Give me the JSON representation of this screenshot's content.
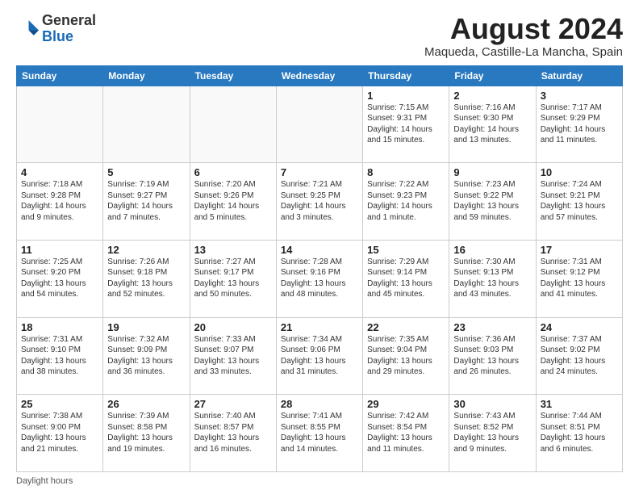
{
  "header": {
    "logo_general": "General",
    "logo_blue": "Blue",
    "month_title": "August 2024",
    "subtitle": "Maqueda, Castille-La Mancha, Spain"
  },
  "weekdays": [
    "Sunday",
    "Monday",
    "Tuesday",
    "Wednesday",
    "Thursday",
    "Friday",
    "Saturday"
  ],
  "weeks": [
    [
      {
        "day": "",
        "info": ""
      },
      {
        "day": "",
        "info": ""
      },
      {
        "day": "",
        "info": ""
      },
      {
        "day": "",
        "info": ""
      },
      {
        "day": "1",
        "info": "Sunrise: 7:15 AM\nSunset: 9:31 PM\nDaylight: 14 hours\nand 15 minutes."
      },
      {
        "day": "2",
        "info": "Sunrise: 7:16 AM\nSunset: 9:30 PM\nDaylight: 14 hours\nand 13 minutes."
      },
      {
        "day": "3",
        "info": "Sunrise: 7:17 AM\nSunset: 9:29 PM\nDaylight: 14 hours\nand 11 minutes."
      }
    ],
    [
      {
        "day": "4",
        "info": "Sunrise: 7:18 AM\nSunset: 9:28 PM\nDaylight: 14 hours\nand 9 minutes."
      },
      {
        "day": "5",
        "info": "Sunrise: 7:19 AM\nSunset: 9:27 PM\nDaylight: 14 hours\nand 7 minutes."
      },
      {
        "day": "6",
        "info": "Sunrise: 7:20 AM\nSunset: 9:26 PM\nDaylight: 14 hours\nand 5 minutes."
      },
      {
        "day": "7",
        "info": "Sunrise: 7:21 AM\nSunset: 9:25 PM\nDaylight: 14 hours\nand 3 minutes."
      },
      {
        "day": "8",
        "info": "Sunrise: 7:22 AM\nSunset: 9:23 PM\nDaylight: 14 hours\nand 1 minute."
      },
      {
        "day": "9",
        "info": "Sunrise: 7:23 AM\nSunset: 9:22 PM\nDaylight: 13 hours\nand 59 minutes."
      },
      {
        "day": "10",
        "info": "Sunrise: 7:24 AM\nSunset: 9:21 PM\nDaylight: 13 hours\nand 57 minutes."
      }
    ],
    [
      {
        "day": "11",
        "info": "Sunrise: 7:25 AM\nSunset: 9:20 PM\nDaylight: 13 hours\nand 54 minutes."
      },
      {
        "day": "12",
        "info": "Sunrise: 7:26 AM\nSunset: 9:18 PM\nDaylight: 13 hours\nand 52 minutes."
      },
      {
        "day": "13",
        "info": "Sunrise: 7:27 AM\nSunset: 9:17 PM\nDaylight: 13 hours\nand 50 minutes."
      },
      {
        "day": "14",
        "info": "Sunrise: 7:28 AM\nSunset: 9:16 PM\nDaylight: 13 hours\nand 48 minutes."
      },
      {
        "day": "15",
        "info": "Sunrise: 7:29 AM\nSunset: 9:14 PM\nDaylight: 13 hours\nand 45 minutes."
      },
      {
        "day": "16",
        "info": "Sunrise: 7:30 AM\nSunset: 9:13 PM\nDaylight: 13 hours\nand 43 minutes."
      },
      {
        "day": "17",
        "info": "Sunrise: 7:31 AM\nSunset: 9:12 PM\nDaylight: 13 hours\nand 41 minutes."
      }
    ],
    [
      {
        "day": "18",
        "info": "Sunrise: 7:31 AM\nSunset: 9:10 PM\nDaylight: 13 hours\nand 38 minutes."
      },
      {
        "day": "19",
        "info": "Sunrise: 7:32 AM\nSunset: 9:09 PM\nDaylight: 13 hours\nand 36 minutes."
      },
      {
        "day": "20",
        "info": "Sunrise: 7:33 AM\nSunset: 9:07 PM\nDaylight: 13 hours\nand 33 minutes."
      },
      {
        "day": "21",
        "info": "Sunrise: 7:34 AM\nSunset: 9:06 PM\nDaylight: 13 hours\nand 31 minutes."
      },
      {
        "day": "22",
        "info": "Sunrise: 7:35 AM\nSunset: 9:04 PM\nDaylight: 13 hours\nand 29 minutes."
      },
      {
        "day": "23",
        "info": "Sunrise: 7:36 AM\nSunset: 9:03 PM\nDaylight: 13 hours\nand 26 minutes."
      },
      {
        "day": "24",
        "info": "Sunrise: 7:37 AM\nSunset: 9:02 PM\nDaylight: 13 hours\nand 24 minutes."
      }
    ],
    [
      {
        "day": "25",
        "info": "Sunrise: 7:38 AM\nSunset: 9:00 PM\nDaylight: 13 hours\nand 21 minutes."
      },
      {
        "day": "26",
        "info": "Sunrise: 7:39 AM\nSunset: 8:58 PM\nDaylight: 13 hours\nand 19 minutes."
      },
      {
        "day": "27",
        "info": "Sunrise: 7:40 AM\nSunset: 8:57 PM\nDaylight: 13 hours\nand 16 minutes."
      },
      {
        "day": "28",
        "info": "Sunrise: 7:41 AM\nSunset: 8:55 PM\nDaylight: 13 hours\nand 14 minutes."
      },
      {
        "day": "29",
        "info": "Sunrise: 7:42 AM\nSunset: 8:54 PM\nDaylight: 13 hours\nand 11 minutes."
      },
      {
        "day": "30",
        "info": "Sunrise: 7:43 AM\nSunset: 8:52 PM\nDaylight: 13 hours\nand 9 minutes."
      },
      {
        "day": "31",
        "info": "Sunrise: 7:44 AM\nSunset: 8:51 PM\nDaylight: 13 hours\nand 6 minutes."
      }
    ]
  ],
  "footer": {
    "daylight_label": "Daylight hours"
  }
}
